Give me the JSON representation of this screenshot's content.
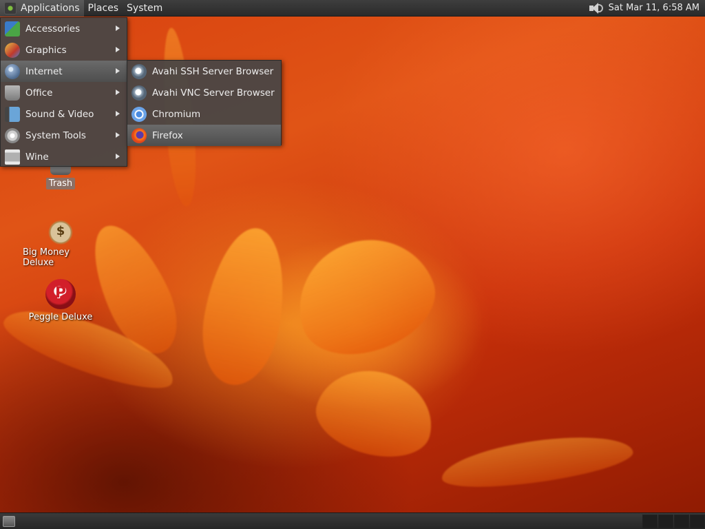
{
  "top_panel": {
    "menus": [
      "Applications",
      "Places",
      "System"
    ],
    "clock": "Sat Mar 11,  6:58 AM"
  },
  "applications_menu": {
    "items": [
      {
        "label": "Accessories",
        "icon": "accessories-icon",
        "has_submenu": true
      },
      {
        "label": "Graphics",
        "icon": "graphics-icon",
        "has_submenu": true
      },
      {
        "label": "Internet",
        "icon": "internet-icon",
        "has_submenu": true,
        "active": true
      },
      {
        "label": "Office",
        "icon": "office-icon",
        "has_submenu": true
      },
      {
        "label": "Sound & Video",
        "icon": "sound-video-icon",
        "has_submenu": true
      },
      {
        "label": "System Tools",
        "icon": "system-tools-icon",
        "has_submenu": true
      },
      {
        "label": "Wine",
        "icon": "wine-icon",
        "has_submenu": true
      }
    ]
  },
  "internet_submenu": {
    "items": [
      {
        "label": "Avahi SSH Server Browser",
        "icon": "avahi-ssh-icon"
      },
      {
        "label": "Avahi VNC Server Browser",
        "icon": "avahi-vnc-icon"
      },
      {
        "label": "Chromium",
        "icon": "chromium-icon"
      },
      {
        "label": "Firefox",
        "icon": "firefox-icon",
        "active": true
      }
    ]
  },
  "desktop_icons": [
    {
      "label": "Trash",
      "icon": "trash-icon"
    },
    {
      "label": "Big Money Deluxe",
      "icon": "money-bag-icon"
    },
    {
      "label": "Peggle Deluxe",
      "icon": "peggle-icon"
    }
  ],
  "bottom_panel": {
    "workspaces": 4
  },
  "colors": {
    "panel": "#2e2e2e",
    "menu_bg": "#464646",
    "menu_highlight": "#5c5c5c",
    "wallpaper": "#d8420f"
  }
}
